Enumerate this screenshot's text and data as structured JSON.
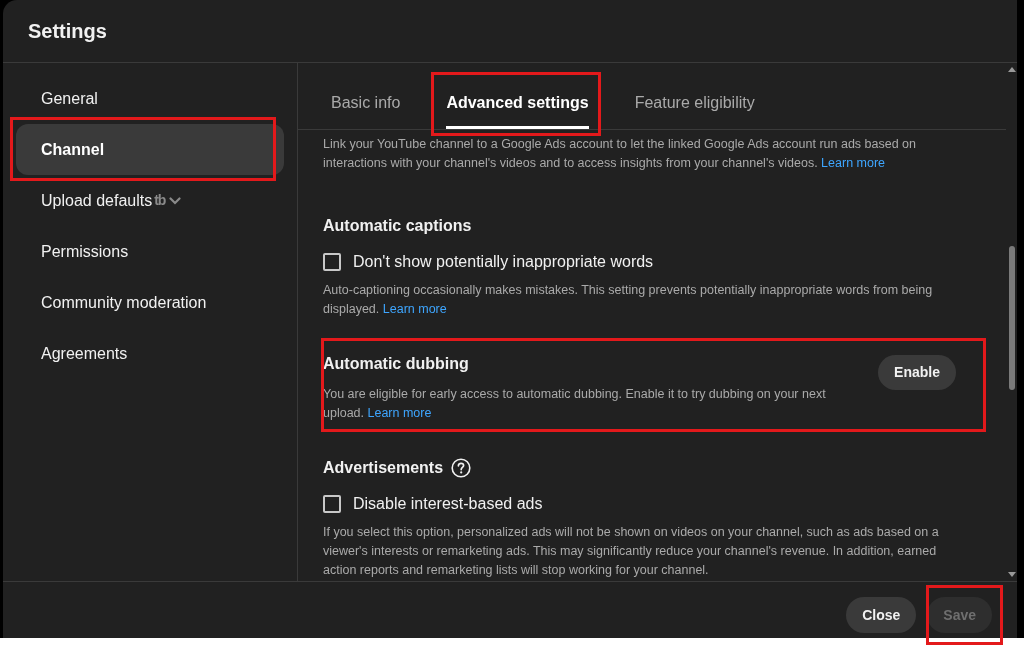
{
  "window": {
    "title": "Settings"
  },
  "sidebar": {
    "items": [
      {
        "label": "General",
        "kind": "page",
        "selected": false,
        "highlighted": false
      },
      {
        "label": "Channel",
        "kind": "page",
        "selected": true,
        "highlighted": true
      },
      {
        "label": "Upload defaults",
        "kind": "group",
        "badge": "tb",
        "expanded": false,
        "selected": false,
        "highlighted": false
      },
      {
        "label": "Permissions",
        "kind": "page",
        "selected": false,
        "highlighted": false
      },
      {
        "label": "Community moderation",
        "kind": "page",
        "selected": false,
        "highlighted": false
      },
      {
        "label": "Agreements",
        "kind": "page",
        "selected": false,
        "highlighted": false
      }
    ]
  },
  "tabs": [
    {
      "label": "Basic info",
      "selected": false,
      "highlighted": false
    },
    {
      "label": "Advanced settings",
      "selected": true,
      "highlighted": true
    },
    {
      "label": "Feature eligibility",
      "selected": false,
      "highlighted": false
    }
  ],
  "sections": [
    {
      "kind": "note",
      "description": "Link your YouTube channel to a Google Ads account to let the linked Google Ads account run ads based on interactions with your channel's videos and to access insights from your channel's videos.",
      "link": "Learn more",
      "highlighted": false
    },
    {
      "kind": "setting",
      "title": "Automatic captions",
      "help": false,
      "options": [
        {
          "label": "Don't show potentially inappropriate words",
          "checked": false
        }
      ],
      "description": "Auto-captioning occasionally makes mistakes. This setting prevents potentially inappropriate words from being displayed.",
      "link": "Learn more",
      "highlighted": false
    },
    {
      "kind": "setting",
      "title": "Automatic dubbing",
      "help": false,
      "description": "You are eligible for early access to automatic dubbing. Enable it to try dubbing on your next upload.",
      "link": "Learn more",
      "action": "Enable",
      "highlighted": true
    },
    {
      "kind": "setting",
      "title": "Advertisements",
      "help": true,
      "options": [
        {
          "label": "Disable interest-based ads",
          "checked": false
        }
      ],
      "description": "If you select this option, personalized ads will not be shown on videos on your channel, such as ads based on a viewer's interests or remarketing ads. This may significantly reduce your channel's revenue. In addition, earned action reports and remarketing lists will stop working for your channel.",
      "highlighted": false
    }
  ],
  "footer": {
    "buttons": [
      {
        "label": "Close",
        "disabled": false,
        "highlighted": false
      },
      {
        "label": "Save",
        "disabled": true,
        "highlighted": true
      }
    ]
  }
}
